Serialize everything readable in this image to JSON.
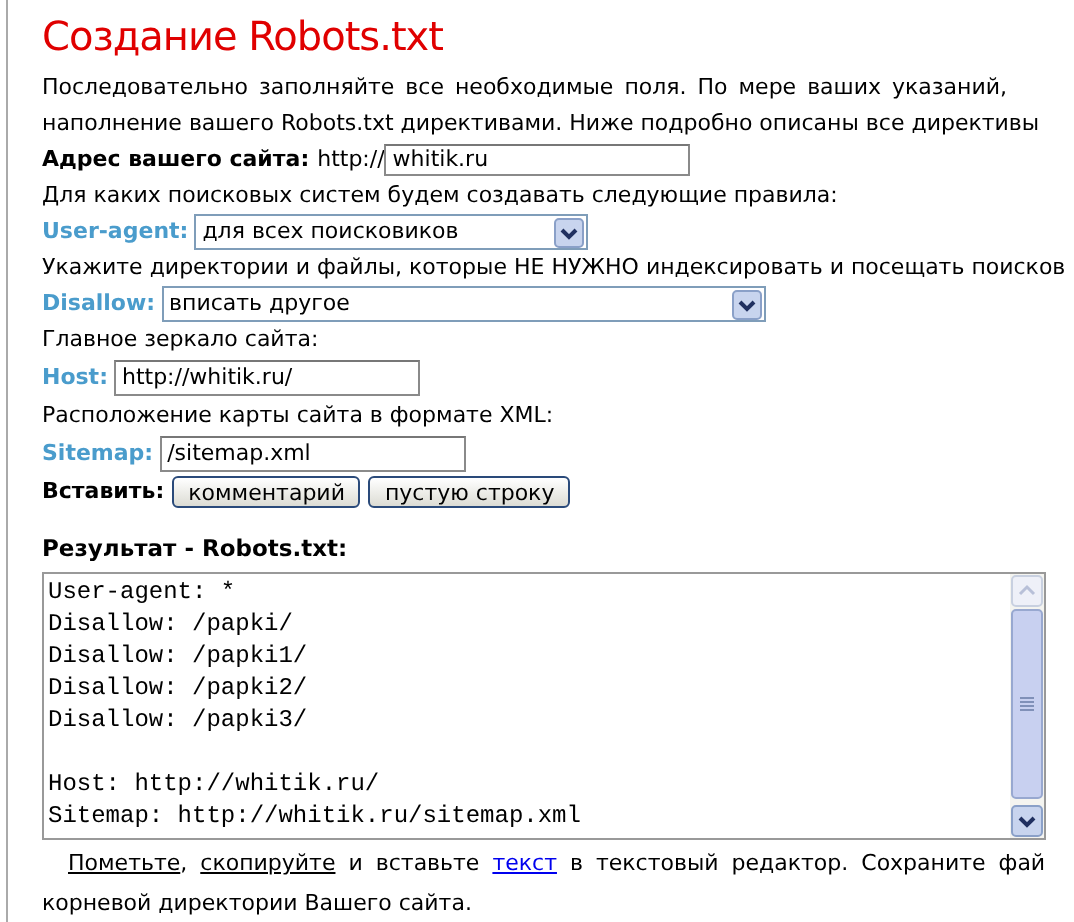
{
  "title": "Создание Robots.txt",
  "intro": {
    "lines": [
      "Последовательно заполняйте все необходимые поля. По мере ваших указаний,",
      "наполнение вашего Robots.txt директивами. Ниже подробно описаны все директивы"
    ]
  },
  "site_address": {
    "label": "Адрес вашего сайта:",
    "prefix": "http://",
    "value": "whitik.ru"
  },
  "engines_prompt": "Для каких поисковых систем будем создавать следующие правила:",
  "user_agent": {
    "label": "User-agent:",
    "value": "для всех поисковиков"
  },
  "disallow_prompt": "Укажите директории и файлы, которые НЕ НУЖНО индексировать и посещать поисков",
  "disallow": {
    "label": "Disallow:",
    "value": "вписать другое"
  },
  "mirror_prompt": "Главное зеркало сайта:",
  "host": {
    "label": "Host:",
    "value": "http://whitik.ru/"
  },
  "sitemap_prompt": "Расположение карты сайта в формате XML:",
  "sitemap": {
    "label": "Sitemap:",
    "value": "/sitemap.xml"
  },
  "insert": {
    "label": "Вставить:",
    "buttons": [
      "комментарий",
      "пустую строку"
    ]
  },
  "result": {
    "heading": "Результат - Robots.txt:",
    "blocks": [
      [
        "User-agent: *",
        "Disallow: /papki/",
        "Disallow: /papki1/",
        "Disallow: /papki2/",
        "Disallow: /papki3/"
      ],
      [
        "Host: http://whitik.ru/",
        "Sitemap: http://whitik.ru/sitemap.xml"
      ]
    ]
  },
  "footer": {
    "lines": [
      [
        {
          "kind": "plain-link",
          "text": "Пометьте"
        },
        {
          "kind": "text",
          "text": ", "
        },
        {
          "kind": "plain-link",
          "text": "скопируйте"
        },
        {
          "kind": "text",
          "text": " и вставьте "
        },
        {
          "kind": "link",
          "text": "текст"
        },
        {
          "kind": "text",
          "text": " в текстовый редактор. Сохраните фай"
        }
      ],
      [
        {
          "kind": "text",
          "text": "корневой директории Вашего сайта."
        }
      ]
    ]
  }
}
